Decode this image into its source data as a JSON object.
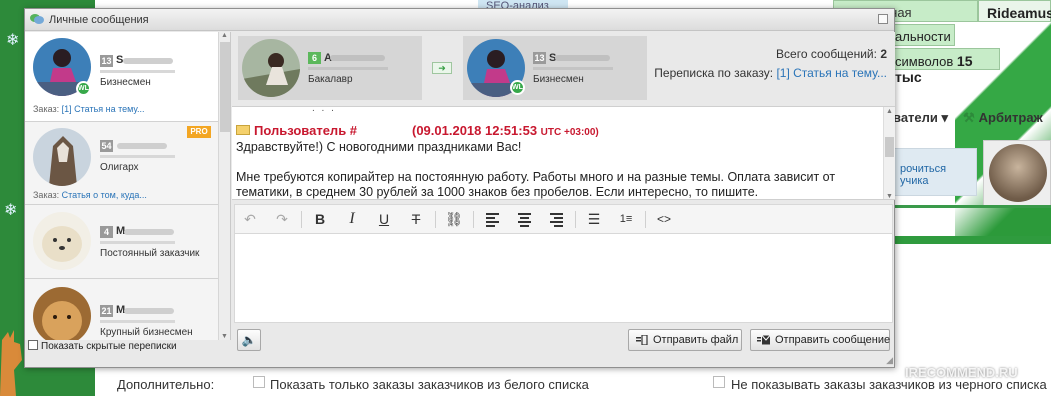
{
  "background": {
    "tabs": {
      "seo": "SEO-анализ",
      "check": "Регулярная проверка",
      "user": "Rideamus",
      "dost": "альности",
      "symbols_prefix": "символов",
      "symbols_value": "15 тыс"
    },
    "menu": {
      "dropdown": "ватели",
      "arbitrage": "Арбитраж"
    },
    "banner": "рочиться\nучика",
    "bottom": {
      "label": "Дополнительно:",
      "white_list": "Показать только заказы заказчиков из белого списка",
      "black_list": "Не показывать заказы заказчиков из черного списка"
    },
    "watermark": "IRECOMMEND.RU"
  },
  "dialog": {
    "title": "Личные сообщения",
    "contacts": [
      {
        "level": "13",
        "initial": "S",
        "role": "Бизнесмен",
        "order_prefix": "Заказ:",
        "order_link": "[1] Статья на тему...",
        "badge": "WL"
      },
      {
        "level": "54",
        "initial": "",
        "role": "Олигарх",
        "order_prefix": "Заказ:",
        "order_link": "Статья о том, куда...",
        "badge": "PRO"
      },
      {
        "level": "4",
        "initial": "M",
        "role": "Постоянный заказчик"
      },
      {
        "level": "21",
        "initial": "M",
        "role": "Крупный бизнесмен"
      }
    ],
    "show_hidden_label": "Показать скрытые переписки",
    "participants": [
      {
        "level": "6",
        "initial": "A",
        "role": "Бакалавр",
        "level_color": "#5cb85c"
      },
      {
        "level": "13",
        "initial": "S",
        "role": "Бизнесмен",
        "badge": "WL",
        "level_color": "#9a9a9a"
      }
    ],
    "total_messages_label": "Всего сообщений:",
    "total_messages_value": "2",
    "order_label": "Переписка по заказу:",
    "order_link": "[1] Статья на тему...",
    "message": {
      "author": "Пользователь #",
      "timestamp": "(09.01.2018 12:51:53",
      "tz": "UTC +03:00)",
      "greeting": "Здравствуйте!) С новогодними праздниками Вас!",
      "body": "Мне требуются копирайтер на постоянную работу. Работы много и на разные темы. Оплата зависит от тематики, в среднем 30 рублей за 1000 знаков без пробелов. Если интересно, то пишите."
    },
    "toolbar_icons": [
      "undo-icon",
      "redo-icon",
      "bold-icon",
      "italic-icon",
      "underline-icon",
      "clear-format-icon",
      "link-icon",
      "align-left-icon",
      "align-center-icon",
      "align-right-icon",
      "bullet-list-icon",
      "numbered-list-icon",
      "source-code-icon"
    ],
    "buttons": {
      "send_file": "Отправить файл",
      "send_message": "Отправить сообщение"
    }
  },
  "colors": {
    "accent_green": "#37a84a",
    "author_red": "#c8182f",
    "link_blue": "#2a74b8",
    "pro_orange": "#f3a623"
  }
}
